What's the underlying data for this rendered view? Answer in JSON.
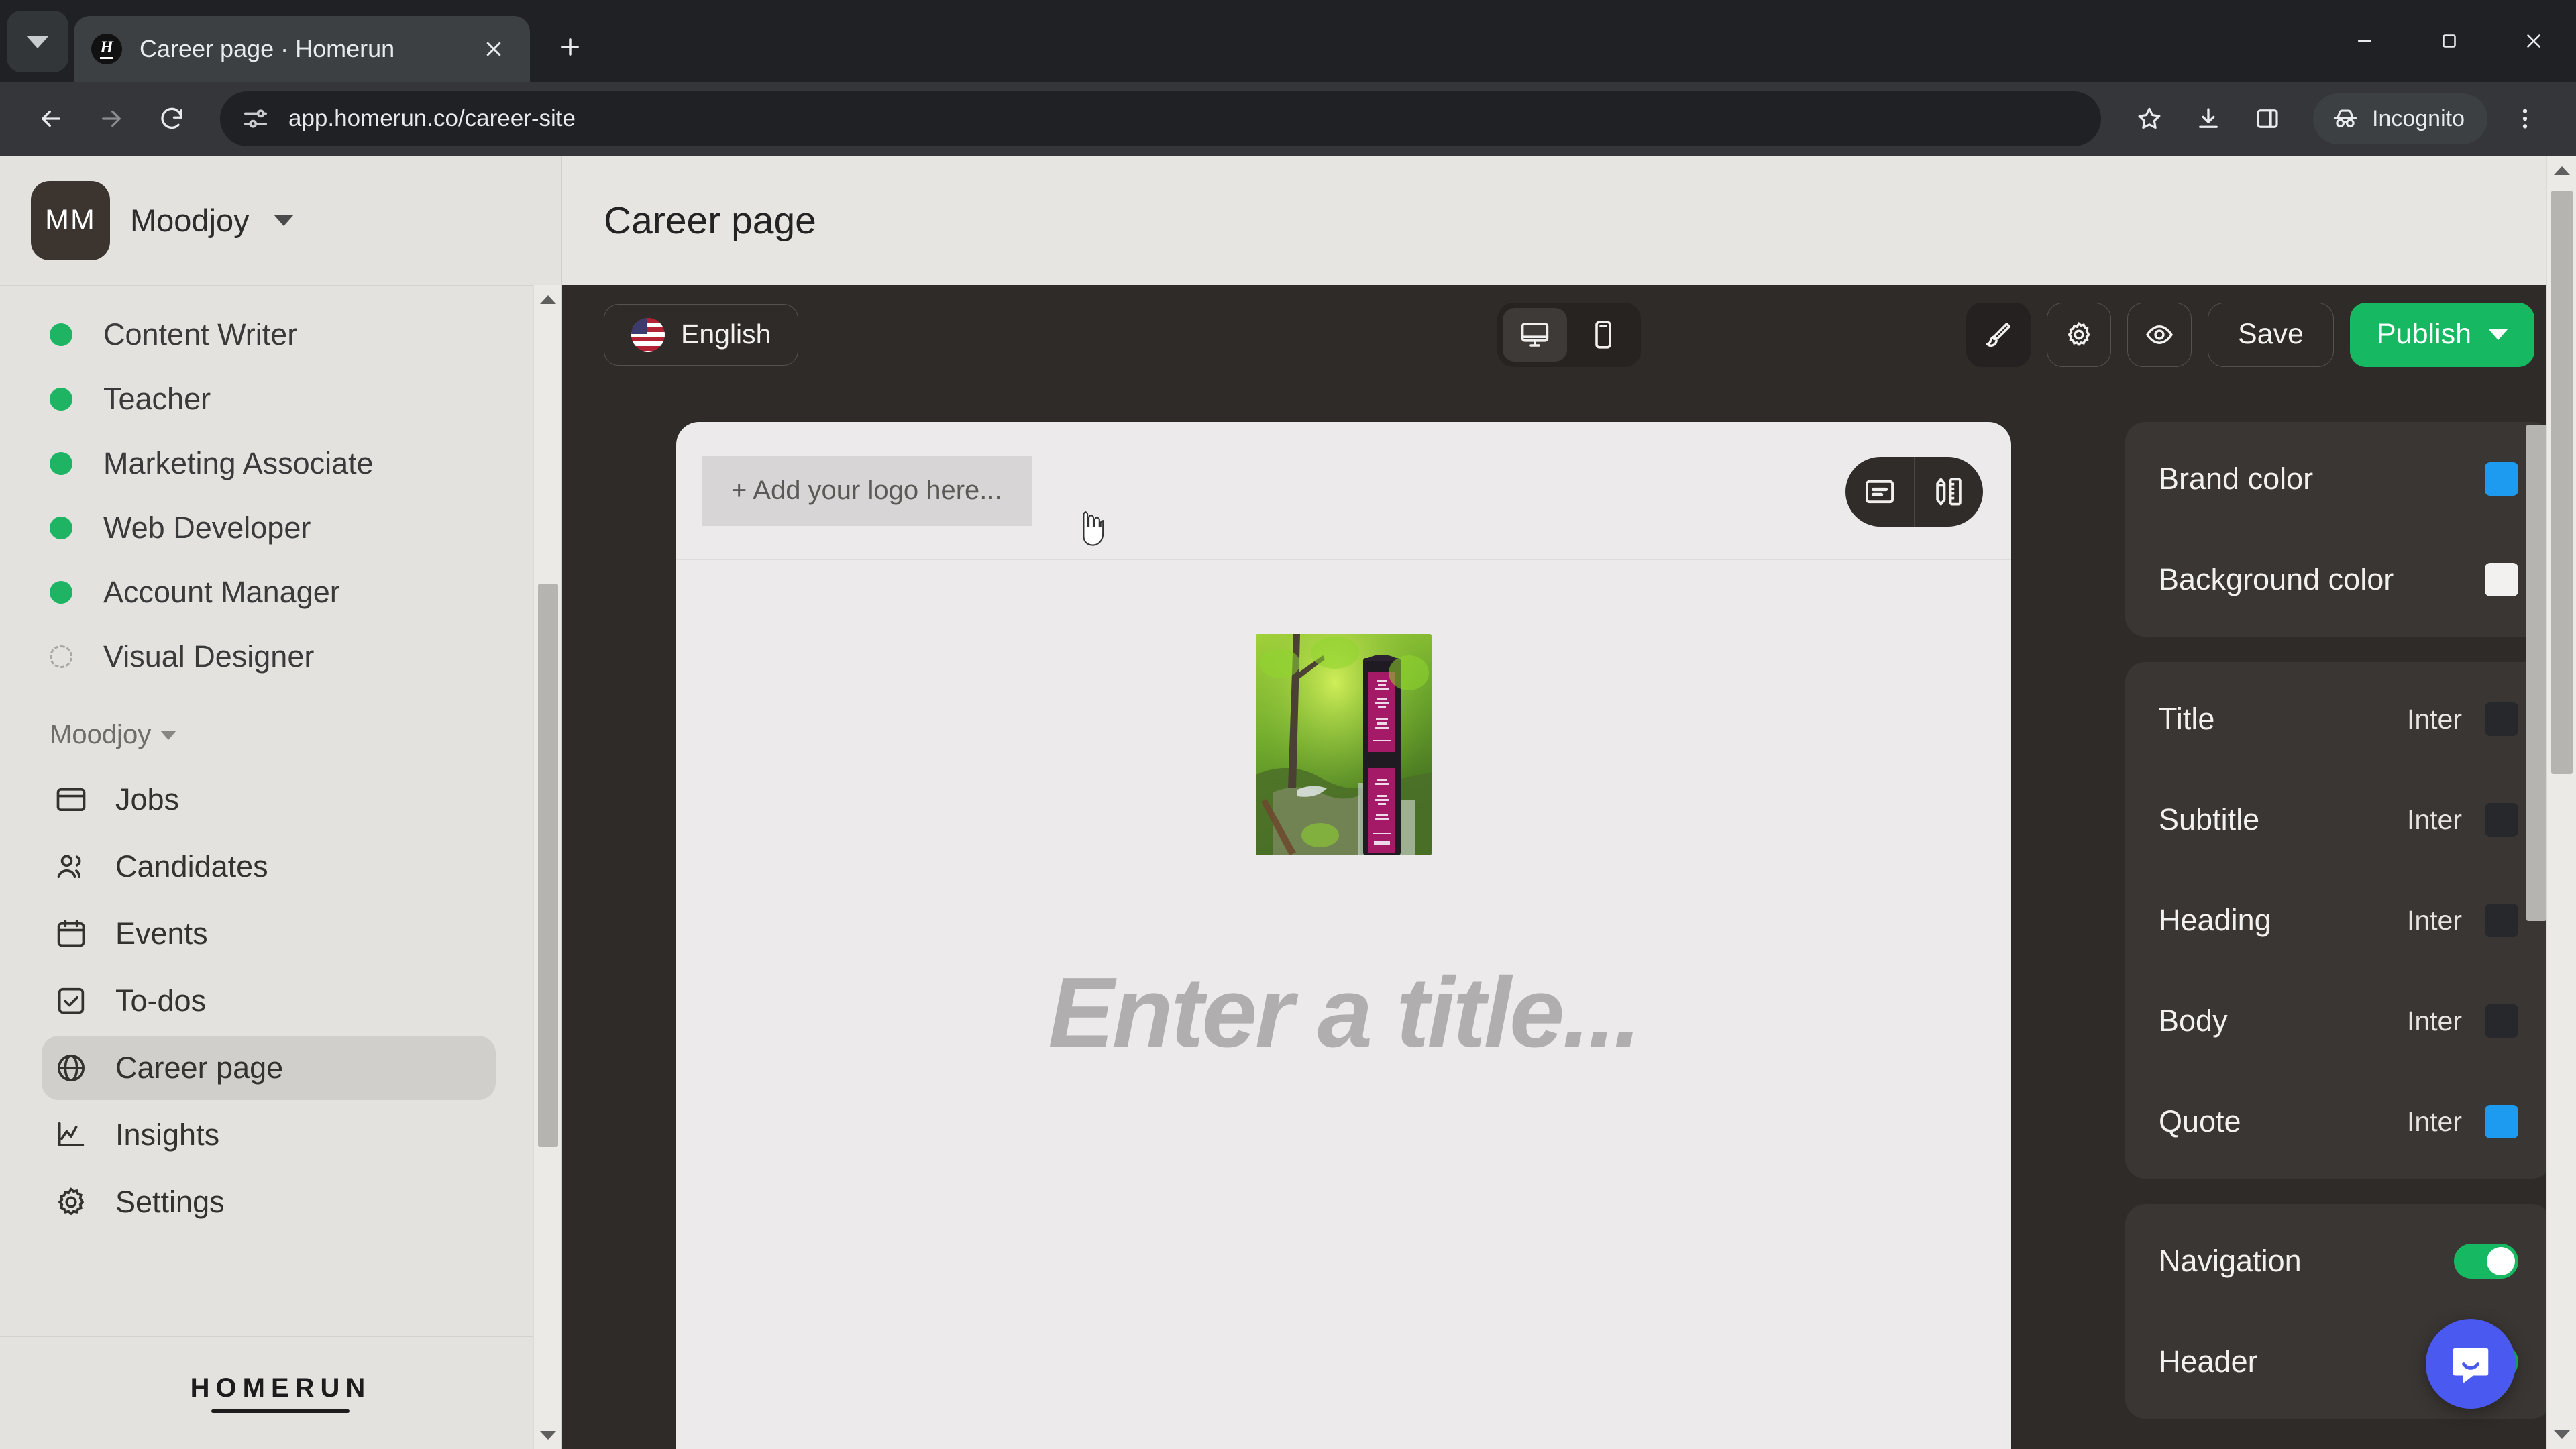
{
  "browser": {
    "tab": {
      "title": "Career page · Homerun",
      "favicon_letter": "H"
    },
    "url": "app.homerun.co/career-site",
    "profile_label": "Incognito",
    "icons": {
      "tab_list": "chevron-down-icon",
      "new_tab": "plus-icon",
      "close_tab": "close-icon",
      "back": "back-arrow-icon",
      "forward": "forward-arrow-icon",
      "reload": "reload-icon",
      "site_info": "site-settings-icon",
      "bookmark": "star-icon",
      "downloads": "download-icon",
      "side_panel": "side-panel-icon",
      "menu": "kebab-menu-icon",
      "minimize": "minimize-icon",
      "maximize": "maximize-icon",
      "window_close": "window-close-icon"
    }
  },
  "sidebar": {
    "org": {
      "name": "Moodjoy",
      "initials": "MM"
    },
    "jobs": [
      {
        "label": "Content Writer",
        "status": "published"
      },
      {
        "label": "Teacher",
        "status": "published"
      },
      {
        "label": "Marketing Associate",
        "status": "published"
      },
      {
        "label": "Web Developer",
        "status": "published"
      },
      {
        "label": "Account Manager",
        "status": "published"
      },
      {
        "label": "Visual Designer",
        "status": "draft"
      }
    ],
    "section_label": "Moodjoy",
    "nav": [
      {
        "label": "Jobs",
        "icon": "jobs-icon",
        "active": false
      },
      {
        "label": "Candidates",
        "icon": "candidates-icon",
        "active": false
      },
      {
        "label": "Events",
        "icon": "calendar-icon",
        "active": false
      },
      {
        "label": "To-dos",
        "icon": "checkbox-icon",
        "active": false
      },
      {
        "label": "Career page",
        "icon": "globe-icon",
        "active": true
      },
      {
        "label": "Insights",
        "icon": "chart-line-icon",
        "active": false
      },
      {
        "label": "Settings",
        "icon": "gear-icon",
        "active": false
      }
    ],
    "brand_wordmark": "HOMERUN"
  },
  "page": {
    "title": "Career page"
  },
  "editor_toolbar": {
    "language": "English",
    "language_flag": "us-flag-icon",
    "device_desktop": "desktop-icon",
    "device_mobile": "mobile-icon",
    "active_device": "desktop",
    "design_icon": "paintbrush-icon",
    "settings_icon": "gear-icon",
    "preview_icon": "eye-icon",
    "save_label": "Save",
    "publish_label": "Publish"
  },
  "canvas": {
    "logo_placeholder": "+ Add your logo here...",
    "title_placeholder": "Enter a title...",
    "overlay": {
      "content_icon": "content-block-icon",
      "design_icon": "pencil-ruler-icon"
    },
    "hero_image_alt": "forest-waterfall-signpost-photo"
  },
  "settings_panel": {
    "colors": [
      {
        "label": "Brand color",
        "value": "#1d9bf0"
      },
      {
        "label": "Background color",
        "value": "#f2f1ef"
      }
    ],
    "typography": [
      {
        "label": "Title",
        "font": "Inter",
        "color": "#26282c"
      },
      {
        "label": "Subtitle",
        "font": "Inter",
        "color": "#26282c"
      },
      {
        "label": "Heading",
        "font": "Inter",
        "color": "#26282c"
      },
      {
        "label": "Body",
        "font": "Inter",
        "color": "#26282c"
      },
      {
        "label": "Quote",
        "font": "Inter",
        "color": "#1d9bf0"
      }
    ],
    "toggles": [
      {
        "label": "Navigation",
        "on": true
      },
      {
        "label": "Header",
        "on": true
      }
    ]
  },
  "widgets": {
    "intercom": "chat-bubble-icon"
  }
}
